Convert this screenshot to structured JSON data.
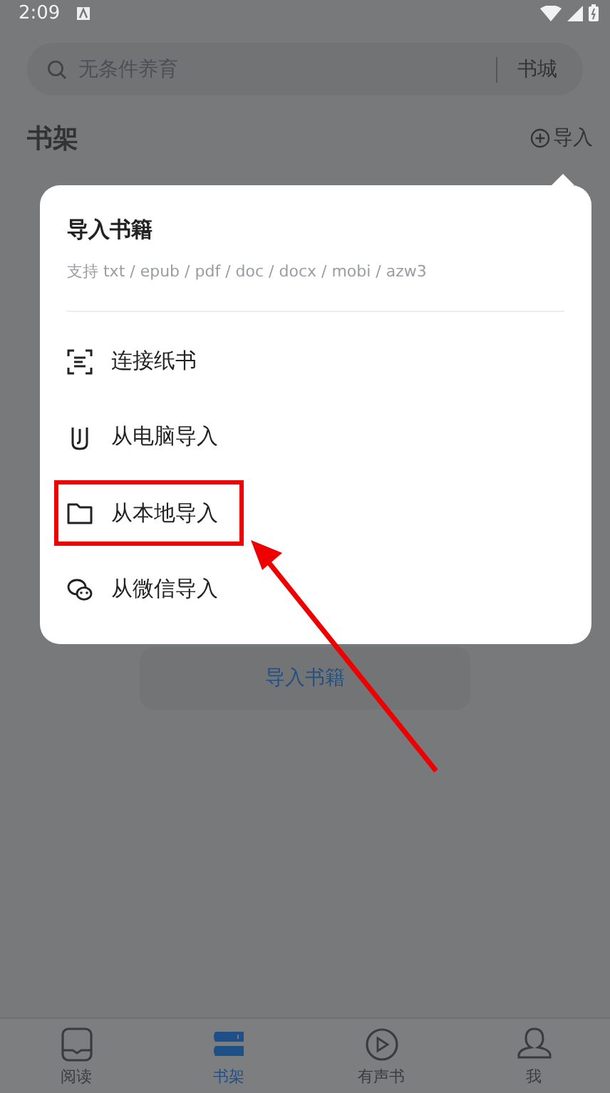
{
  "status_bar": {
    "time": "2:09"
  },
  "search": {
    "placeholder": "无条件养育",
    "store_link": "书城"
  },
  "shelf": {
    "title": "书架",
    "import_label": "导入",
    "empty_button": "导入书籍"
  },
  "import_menu": {
    "title": "导入书籍",
    "formats": "支持 txt / epub / pdf / doc / docx / mobi / azw3",
    "items": [
      {
        "kind": "scan",
        "label": "连接纸书",
        "highlighted": false
      },
      {
        "kind": "computer",
        "label": "从电脑导入",
        "highlighted": false
      },
      {
        "kind": "folder",
        "label": "从本地导入",
        "highlighted": true
      },
      {
        "kind": "wechat",
        "label": "从微信导入",
        "highlighted": false
      }
    ]
  },
  "nav": [
    {
      "kind": "read",
      "label": "阅读",
      "selected": false
    },
    {
      "kind": "shelf",
      "label": "书架",
      "selected": true
    },
    {
      "kind": "audio",
      "label": "有声书",
      "selected": false
    },
    {
      "kind": "me",
      "label": "我",
      "selected": false
    }
  ]
}
